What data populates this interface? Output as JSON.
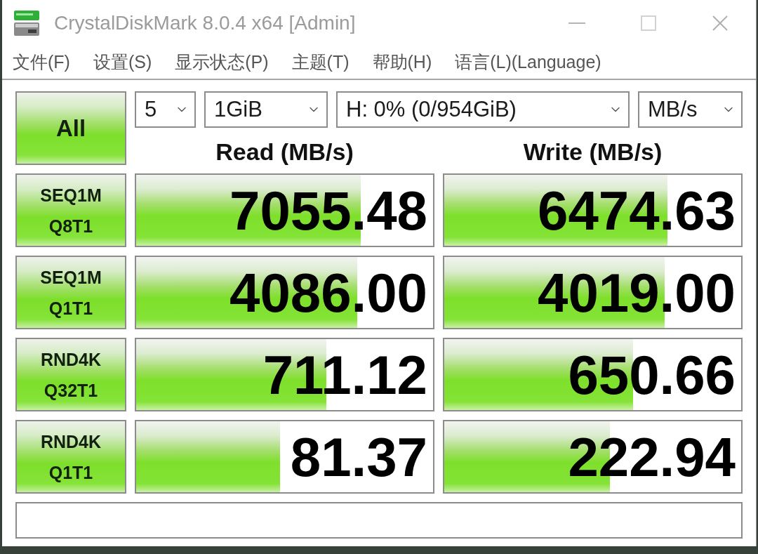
{
  "window": {
    "title": "CrystalDiskMark 8.0.4 x64 [Admin]"
  },
  "menu": [
    "文件(F)",
    "设置(S)",
    "显示状态(P)",
    "主题(T)",
    "帮助(H)",
    "语言(L)(Language)"
  ],
  "run_all_button": "All",
  "selects": [
    "5",
    "1GiB",
    "H: 0% (0/954GiB)",
    "MB/s"
  ],
  "columns": [
    "Read (MB/s)",
    "Write (MB/s)"
  ],
  "tests": [
    {
      "lines": [
        "SEQ1M",
        "Q8T1"
      ],
      "read": {
        "value": "7055.48",
        "level": 0.757
      },
      "write": {
        "value": "6474.63",
        "level": 0.752
      }
    },
    {
      "lines": [
        "SEQ1M",
        "Q1T1"
      ],
      "read": {
        "value": "4086.00",
        "level": 0.745
      },
      "write": {
        "value": "4019.00",
        "level": 0.742
      }
    },
    {
      "lines": [
        "RND4K",
        "Q32T1"
      ],
      "read": {
        "value": "711.12",
        "level": 0.64
      },
      "write": {
        "value": "650.66",
        "level": 0.637
      }
    },
    {
      "lines": [
        "RND4K",
        "Q1T1"
      ],
      "read": {
        "value": "81.37",
        "level": 0.484
      },
      "write": {
        "value": "222.94",
        "level": 0.557
      }
    }
  ]
}
